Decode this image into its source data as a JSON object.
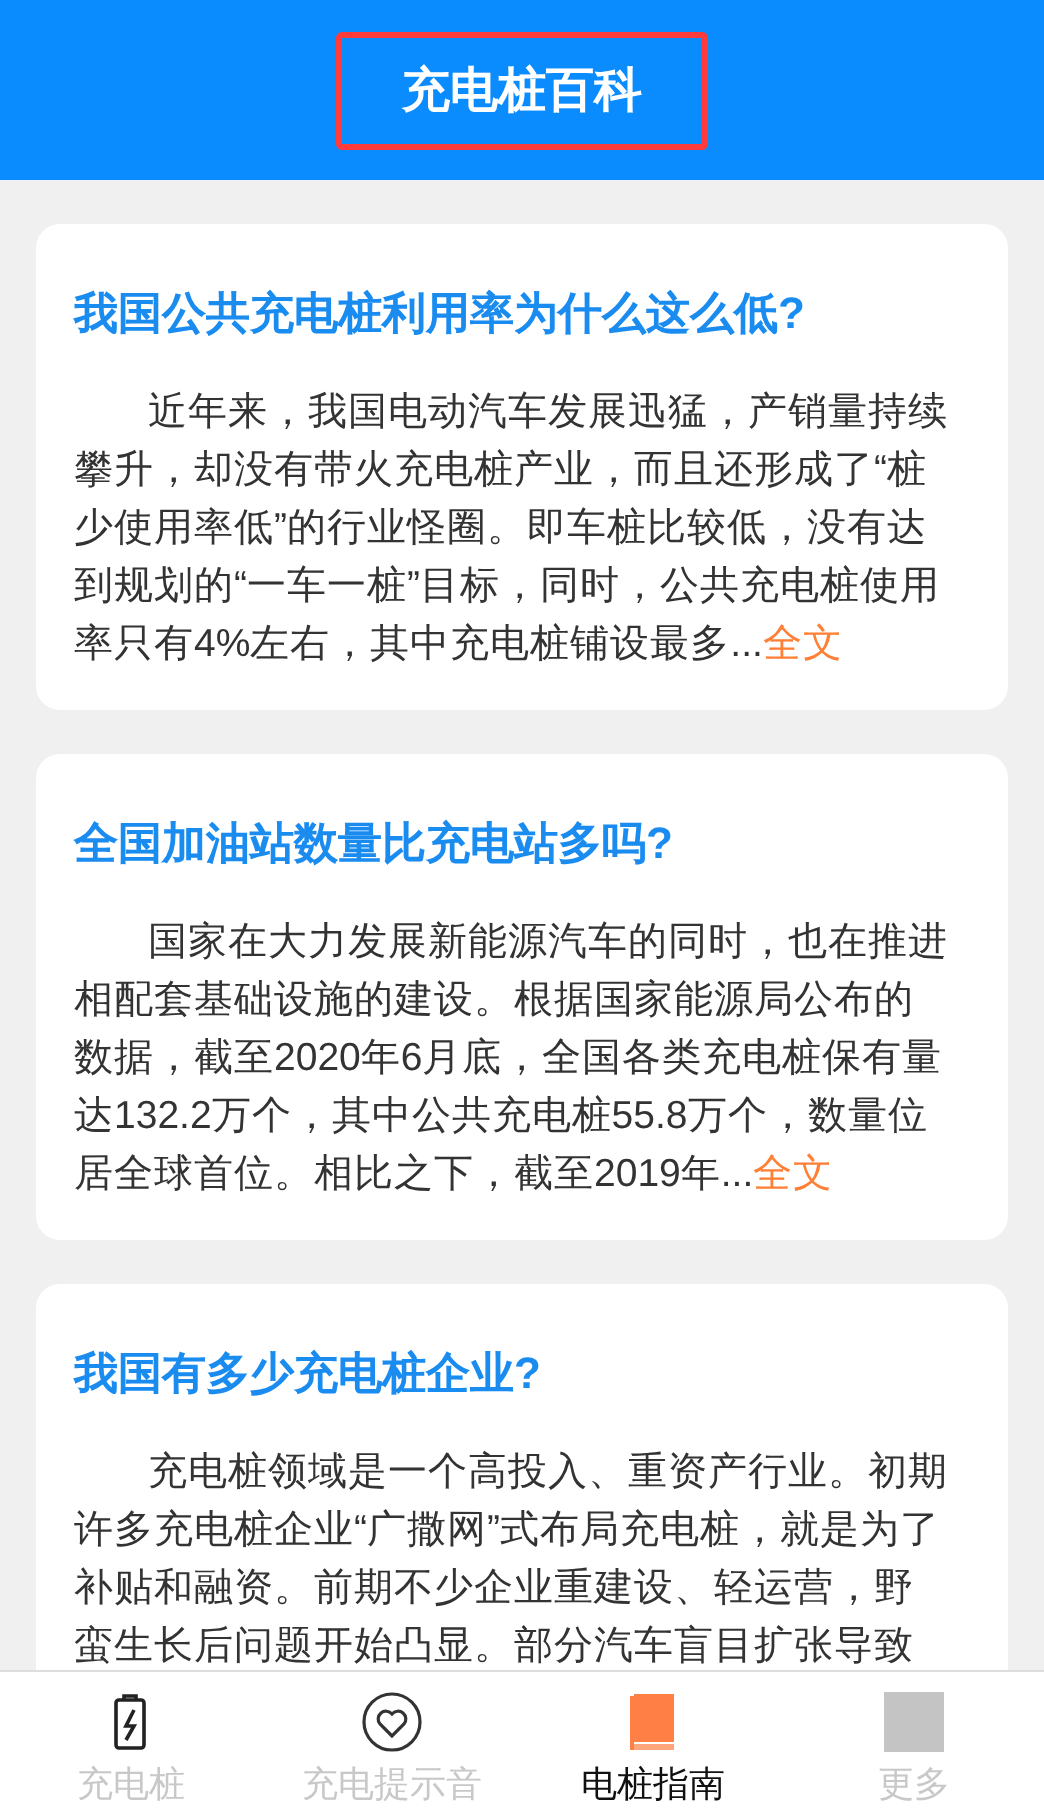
{
  "header": {
    "title": "充电桩百科"
  },
  "articles": [
    {
      "title": "我国公共充电桩利用率为什么这么低?",
      "body": "近年来，我国电动汽车发展迅猛，产销量持续攀升，却没有带火充电桩产业，而且还形成了“桩少使用率低”的行业怪圈。即车桩比较低，没有达到规划的“一车一桩”目标，同时，公共充电桩使用率只有4%左右，其中充电桩铺设最多...",
      "more": "全文"
    },
    {
      "title": "全国加油站数量比充电站多吗?",
      "body": "国家在大力发展新能源汽车的同时，也在推进相配套基础设施的建设。根据国家能源局公布的数据，截至2020年6月底，全国各类充电桩保有量达132.2万个，其中公共充电桩55.8万个，数量位居全球首位。相比之下，截至2019年...",
      "more": "全文"
    },
    {
      "title": "我国有多少充电桩企业?",
      "body": "充电桩领域是一个高投入、重资产行业。初期许多充电桩企业“广撒网”式布局充电桩，就是为了补贴和融资。前期不少企业重建设、轻运营，野蛮生长后问题开始凸显。部分汽车盲目扩张导致"
    }
  ],
  "tabs": [
    {
      "label": "充电桩",
      "kind": "battery",
      "selected": false
    },
    {
      "label": "充电提示音",
      "kind": "heart",
      "selected": false
    },
    {
      "label": "电桩指南",
      "kind": "book",
      "selected": true
    },
    {
      "label": "更多",
      "kind": "image",
      "selected": false
    }
  ]
}
